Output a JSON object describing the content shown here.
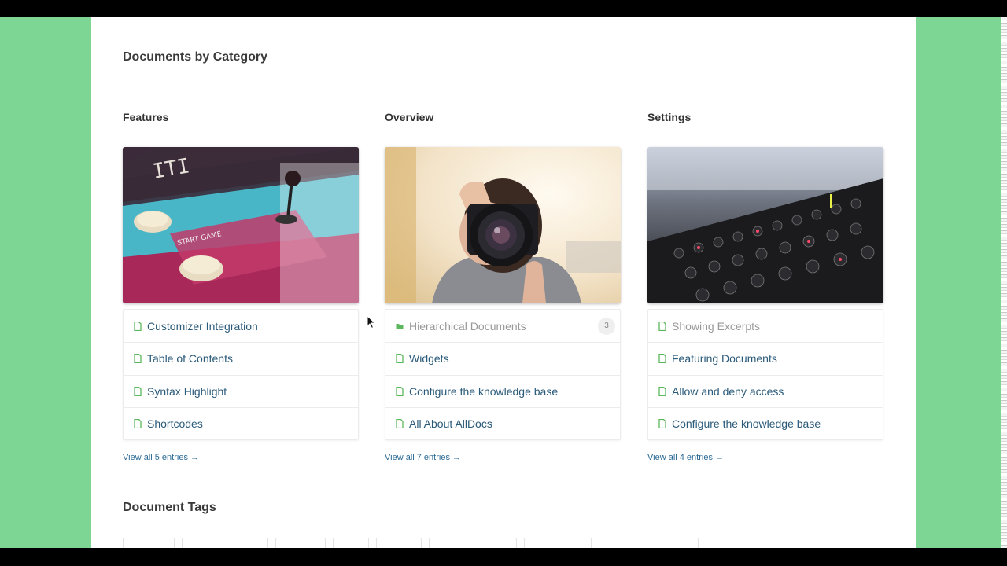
{
  "page": {
    "heading": "Documents by Category",
    "tags_heading": "Document Tags"
  },
  "categories": [
    {
      "title": "Features",
      "image": "arcade-cabinet-photo",
      "items": [
        {
          "label": "Customizer Integration",
          "icon": "document-icon"
        },
        {
          "label": "Table of Contents",
          "icon": "document-icon"
        },
        {
          "label": "Syntax Highlight",
          "icon": "document-icon"
        },
        {
          "label": "Shortcodes",
          "icon": "document-icon"
        }
      ],
      "view_all": "View all 5 entries →"
    },
    {
      "title": "Overview",
      "image": "photographer-camera-photo",
      "items": [
        {
          "label": "Hierarchical Documents",
          "icon": "folder-icon",
          "count": "3"
        },
        {
          "label": "Widgets",
          "icon": "document-icon"
        },
        {
          "label": "Configure the knowledge base",
          "icon": "document-icon"
        },
        {
          "label": "All About AllDocs",
          "icon": "document-icon"
        }
      ],
      "view_all": "View all 7 entries →"
    },
    {
      "title": "Settings",
      "image": "audio-mixer-photo",
      "items": [
        {
          "label": "Showing Excerpts",
          "icon": "document-icon"
        },
        {
          "label": "Featuring Documents",
          "icon": "document-icon"
        },
        {
          "label": "Allow and deny access",
          "icon": "document-icon"
        },
        {
          "label": "Configure the knowledge base",
          "icon": "document-icon"
        }
      ],
      "view_all": "View all 4 entries →"
    }
  ],
  "colors": {
    "background": "#7dd693",
    "link": "#2a5a7a",
    "icon_green": "#5cb85c",
    "muted": "#999999"
  }
}
